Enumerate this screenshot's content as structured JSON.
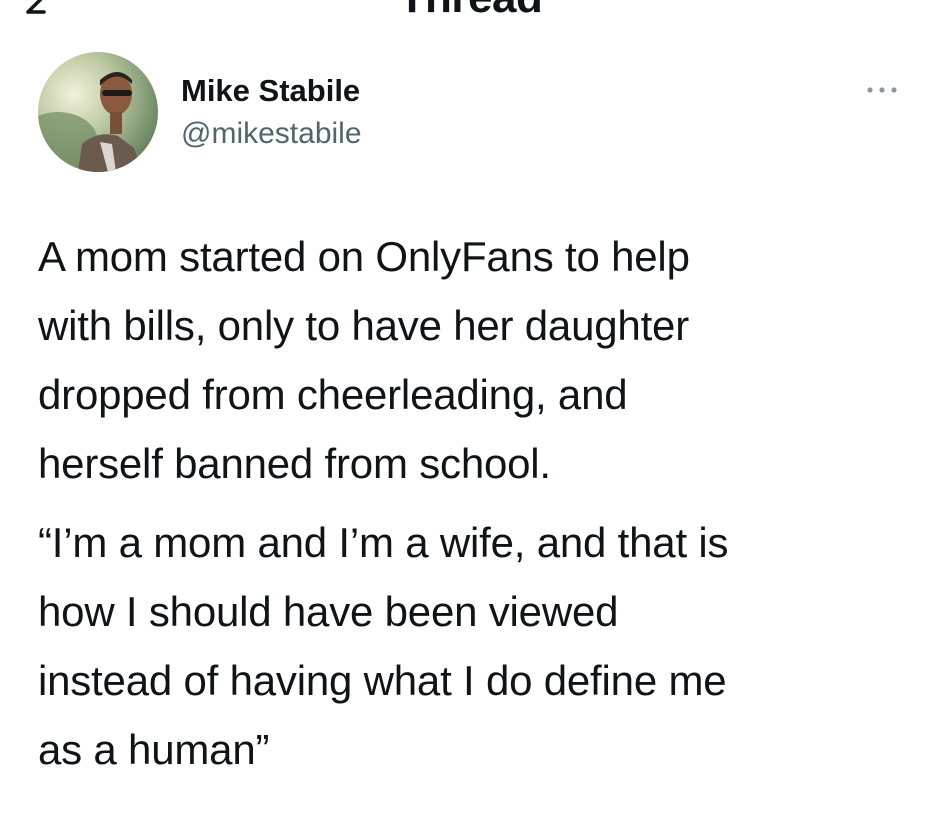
{
  "header": {
    "title": "Thread",
    "back_icon": "arrow-left-icon"
  },
  "tweet": {
    "author_name": "Mike Stabile",
    "author_handle": "@mikestabile",
    "more_icon": "more-horizontal-icon",
    "paragraphs": [
      "A mom started on OnlyFans to help\nwith bills, only to have her daughter\ndropped from cheerleading, and\nherself banned from school.",
      "“I’m a mom and I’m a wife, and that is\nhow I should have been viewed\ninstead of having what I do define me\nas a human”"
    ]
  },
  "colors": {
    "text": "#0f1419",
    "secondary_text": "#536471",
    "background": "#ffffff"
  }
}
